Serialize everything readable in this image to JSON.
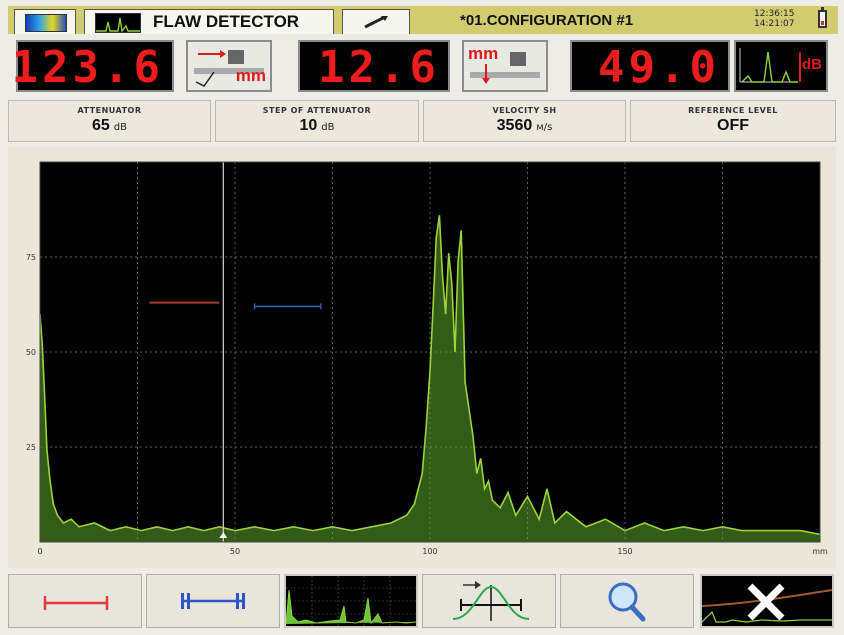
{
  "tabs": {
    "display_tab_icon": "color-palette-icon",
    "detector_title": "FLAW DETECTOR",
    "settings_tab_icon": "wrench-icon"
  },
  "header": {
    "configuration": "*01.CONFIGURATION #1",
    "time": "12:36:15",
    "time2": "14:21:07",
    "battery_level": 0.25
  },
  "readouts": {
    "sound_path": "123.6",
    "sound_path_unit": "mm",
    "depth": "12.6",
    "depth_unit": "mm",
    "amplitude": "49.0",
    "amplitude_unit": "dB"
  },
  "params": {
    "attenuator": {
      "label": "ATTENUATOR",
      "value": "65",
      "unit": "dB"
    },
    "step": {
      "label": "STEP OF ATTENUATOR",
      "value": "10",
      "unit": "dB"
    },
    "velocity": {
      "label": "VELOCITY SH",
      "value": "3560",
      "unit": "м/s"
    },
    "reference": {
      "label": "REFERENCE LEVEL",
      "value": "OFF"
    }
  },
  "colors": {
    "digit_red": "#ee1c1c",
    "signal_green": "#9ed23a",
    "gate_a": "#a0402e",
    "gate_b": "#3a5ca8",
    "tab_bar": "#d2cc70"
  },
  "chart_data": {
    "type": "line",
    "x_ticks": [
      "0",
      "50",
      "100",
      "150",
      "mm"
    ],
    "y_ticks": [
      "75",
      "50",
      "25"
    ],
    "xlim": [
      0,
      200
    ],
    "ylim": [
      0,
      100
    ],
    "grid": true,
    "cursor_x": 47,
    "gate_a": {
      "start": 28,
      "end": 46,
      "level": 63
    },
    "gate_b": {
      "start": 55,
      "end": 72,
      "level": 62
    },
    "series": [
      {
        "x": [
          0,
          0.6,
          1.2,
          1.8,
          2.6,
          3.4,
          4.5,
          6,
          8,
          10,
          14,
          18,
          22,
          26,
          30,
          34,
          38,
          42,
          46,
          50,
          55,
          60,
          65,
          70,
          75,
          80,
          85,
          90,
          94,
          96,
          98,
          99,
          100,
          100.8,
          101.6,
          102.4,
          103.2,
          104,
          104.8,
          105.6,
          106.4,
          107.2,
          108,
          109,
          110,
          111,
          112,
          113,
          114,
          115,
          116,
          118,
          120,
          122,
          125,
          128,
          130,
          132,
          135,
          140,
          145,
          150,
          155,
          160,
          165,
          170,
          175,
          180,
          185,
          190,
          195,
          200
        ],
        "y": [
          60,
          52,
          38,
          24,
          16,
          10,
          7,
          5,
          6,
          4,
          5,
          3,
          4,
          3,
          4,
          3,
          4,
          3,
          4,
          3,
          4,
          3,
          4,
          3,
          4,
          3,
          4,
          5,
          7,
          10,
          18,
          30,
          45,
          62,
          80,
          86,
          70,
          60,
          76,
          68,
          50,
          74,
          82,
          42,
          35,
          28,
          18,
          22,
          14,
          16,
          11,
          9,
          13,
          7,
          12,
          6,
          14,
          5,
          8,
          4,
          6,
          3,
          5,
          3,
          4,
          3,
          4,
          3,
          3,
          3,
          3,
          2
        ]
      }
    ]
  }
}
